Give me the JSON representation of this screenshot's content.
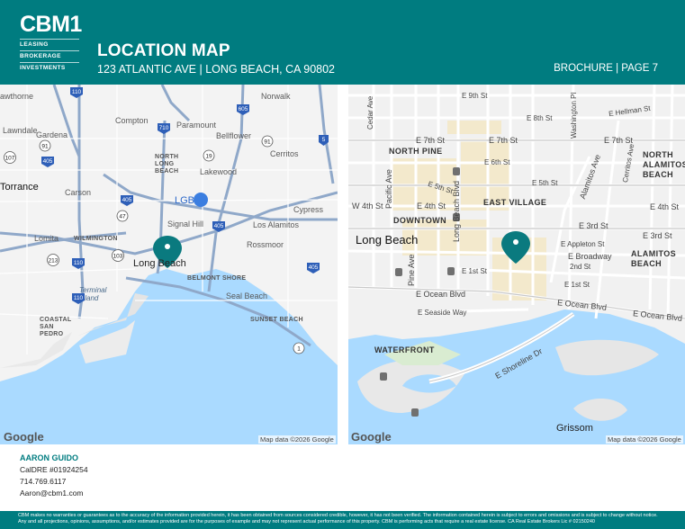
{
  "brand": {
    "logo_word": "CBM1",
    "logo_lines": [
      "LEASING",
      "BROKERAGE",
      "INVESTMENTS"
    ]
  },
  "header": {
    "title": "LOCATION MAP",
    "subtitle": "123 ATLANTIC AVE | LONG BEACH, CA 90802",
    "page_ref": "BROCHURE | PAGE 7"
  },
  "colors": {
    "brand": "#007c80",
    "water": "#aadaff",
    "land": "#f3f3f3",
    "freeway": "#8fa8c9",
    "pin": "#0a7a7f"
  },
  "left_map": {
    "labels": {
      "hawthorne": "awthorne",
      "norwalk": "Norwalk",
      "compton": "Compton",
      "paramount": "Paramount",
      "lawndale": "Lawndale",
      "gardena": "Gardena",
      "bellflower": "Bellflower",
      "cerritos": "Cerritos",
      "north_long_beach": "NORTH LONG BEACH",
      "lakewood": "Lakewood",
      "torrance": "Torrance",
      "carson": "Carson",
      "lgb": "LGB",
      "cypress": "Cypress",
      "signal_hill": "Signal Hill",
      "los_alamitos": "Los Alamitos",
      "lomita": "Lomita",
      "wilmington": "WILMINGTON",
      "rossmoor": "Rossmoor",
      "long_beach": "Long Beach",
      "belmont_shore": "BELMONT SHORE",
      "terminal_island": "Terminal Island",
      "seal_beach": "Seal Beach",
      "coastal_san_pedro": "COASTAL SAN PEDRO",
      "sunset_beach": "SUNSET BEACH"
    },
    "shields": {
      "s110a": "110",
      "s605": "605",
      "s710": "710",
      "s5": "5",
      "s91a": "91",
      "s91b": "91",
      "s107": "107",
      "s405a": "405",
      "s19": "19",
      "s405b": "405",
      "s47": "47",
      "s405c": "405",
      "s213": "213",
      "s110b": "110",
      "s103": "103",
      "s1": "1",
      "s405d": "405",
      "s110c": "110"
    },
    "google": "Google",
    "attribution": "Map data ©2026 Google"
  },
  "right_map": {
    "labels": {
      "e9th": "E 9th St",
      "e8th": "E 8th St",
      "hellman": "E Hellman St",
      "cedar": "Cedar Ave",
      "washington": "Washington Pl",
      "north_pine": "NORTH PINE",
      "e7th_a": "E 7th St",
      "e7th_b": "E 7th St",
      "e7th_c": "E 7th St",
      "north_alamitos": "NORTH ALAMITOS BEACH",
      "e6th": "E 6th St",
      "pacific": "Pacific Ave",
      "e5th_a": "E 5th St",
      "e5th_b": "E 5th St",
      "cerritos_ave": "Cerritos Ave",
      "alamitos_ave": "Alamitos Ave",
      "w4th": "W 4th St",
      "e4th_a": "E 4th St",
      "east_village": "EAST VILLAGE",
      "e4th_b": "E 4th St",
      "lb_blvd": "Long Beach Blvd",
      "downtown": "DOWNTOWN",
      "e3rd_a": "E 3rd St",
      "e3rd_b": "E 3rd St",
      "long_beach": "Long Beach",
      "appleton": "E Appleton St",
      "e_broadway": "E Broadway",
      "alamitos_beach": "ALAMITOS BEACH",
      "pine": "Pine Ave",
      "e1st": "E 1st St",
      "e2nd": "2nd St",
      "e1st_b": "E 1st St",
      "ocean_a": "E Ocean Blvd",
      "ocean_b": "E Ocean Blvd",
      "ocean_c": "E Ocean Blvd",
      "seaside": "E Seaside Way",
      "waterfront": "WATERFRONT",
      "shoreline": "E Shoreline Dr",
      "grissom": "Grissom"
    },
    "google": "Google",
    "attribution": "Map data ©2026 Google"
  },
  "agent": {
    "name": "AARON GUIDO",
    "license": "CalDRE #01924254",
    "phone": "714.769.6117",
    "email": "Aaron@cbm1.com"
  },
  "footer": {
    "disclaimer": "CBM makes no warranties or guarantees as to the accuracy of the information provided herein, it has been obtained from sources considered credible, however, it has not been verified. The information contained herein is subject to errors and omissions and is subject to change without notice. Any and all projections, opinions, assumptions, and/or estimates provided are for the purposes of example and may not represent actual performance of this property. CBM is performing acts that require a real estate license. CA Real Estate Brokers Lic # 02150240"
  }
}
